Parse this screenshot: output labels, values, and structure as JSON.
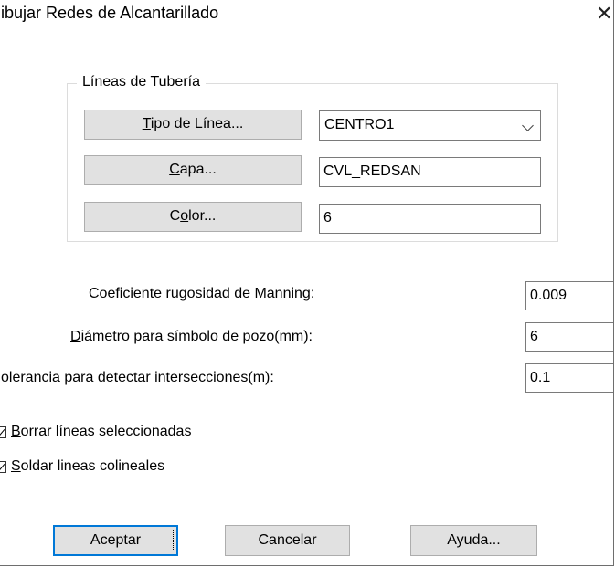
{
  "window": {
    "title": "ibujar Redes de Alcantarillado",
    "close_glyph": "✕"
  },
  "group": {
    "label": "Líneas de Tubería",
    "tipo_linea": {
      "pre": "",
      "mnemonic": "T",
      "post": "ipo de Línea...",
      "value": "CENTRO1"
    },
    "capa": {
      "pre": "",
      "mnemonic": "C",
      "post": "apa...",
      "value": "CVL_REDSAN"
    },
    "color": {
      "pre": "C",
      "mnemonic": "o",
      "post": "lor...",
      "value": "6"
    }
  },
  "params": {
    "manning": {
      "pre": "Coeficiente rugosidad de ",
      "mnemonic": "M",
      "post": "anning:",
      "value": "0.009"
    },
    "diametro": {
      "pre": "",
      "mnemonic": "D",
      "post": "iámetro para símbolo de pozo(mm):",
      "value": "6"
    },
    "tolerancia": {
      "label": "olerancia para detectar intersecciones(m):",
      "value": "0.1"
    }
  },
  "options": {
    "borrar": {
      "mnemonic": "B",
      "post": "orrar líneas seleccionadas",
      "checked": true
    },
    "soldar": {
      "mnemonic": "S",
      "post": "oldar lineas colineales",
      "checked": true
    }
  },
  "buttons": {
    "aceptar": "Aceptar",
    "cancelar": "Cancelar",
    "ayuda": "Ayuda..."
  }
}
